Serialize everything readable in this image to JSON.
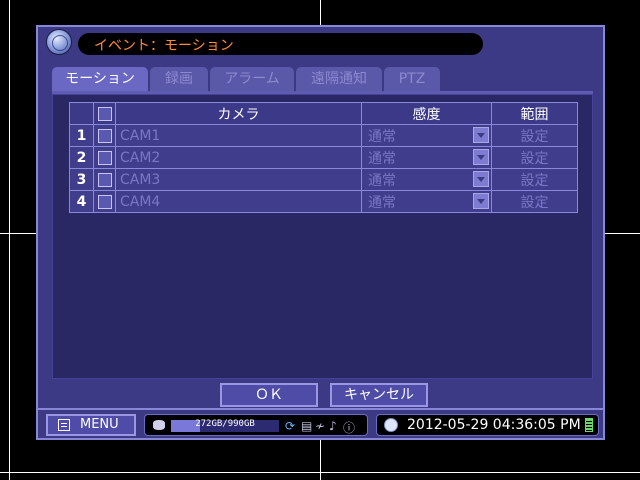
{
  "window": {
    "title": "イベント：モーション"
  },
  "tabs": [
    {
      "label": "モーション",
      "active": true
    },
    {
      "label": "録画",
      "active": false
    },
    {
      "label": "アラーム",
      "active": false
    },
    {
      "label": "遠隔通知",
      "active": false
    },
    {
      "label": "PTZ",
      "active": false
    }
  ],
  "table": {
    "headers": {
      "camera": "カメラ",
      "sensitivity": "感度",
      "range": "範囲"
    },
    "rows": [
      {
        "num": "1",
        "camera": "CAM1",
        "sensitivity": "通常",
        "range": "設定"
      },
      {
        "num": "2",
        "camera": "CAM2",
        "sensitivity": "通常",
        "range": "設定"
      },
      {
        "num": "3",
        "camera": "CAM3",
        "sensitivity": "通常",
        "range": "設定"
      },
      {
        "num": "4",
        "camera": "CAM4",
        "sensitivity": "通常",
        "range": "設定"
      }
    ]
  },
  "buttons": {
    "ok": "ＯＫ",
    "cancel": "キャンセル"
  },
  "statusbar": {
    "menu_label": "MENU",
    "storage": "272GB/990GB",
    "storage_used_fraction": 0.27,
    "datetime": "2012-05-29 04:36:05 PM"
  },
  "colors": {
    "dialog_bg": "#3c3a84",
    "title_text": "#ff8a3a",
    "active_tab": "#6a68c2",
    "disabled_text": "#7a78c4"
  }
}
